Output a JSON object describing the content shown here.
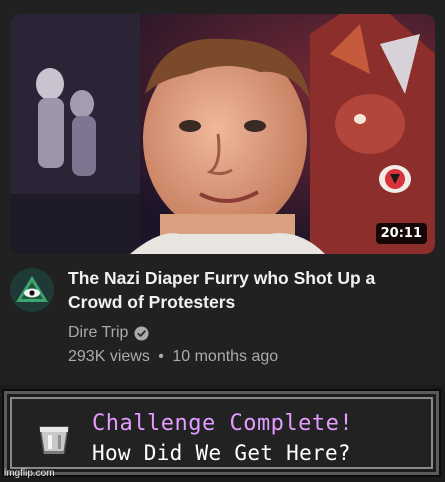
{
  "video": {
    "title": "The Nazi Diaper Furry who Shot Up a Crowd of Protesters",
    "duration": "20:11",
    "channel_name": "Dire Trip",
    "channel_verified": true,
    "views": "293K views",
    "separator": "•",
    "age": "10 months ago",
    "avatar_icon": "eye-triangle-icon",
    "verified_icon": "verified-check-icon"
  },
  "advancement": {
    "title": "Challenge Complete!",
    "description": "How Did We Get Here?",
    "icon": "bucket-icon",
    "title_color": "#e59bff",
    "description_color": "#ffffff"
  },
  "watermark": {
    "text": "imgflip.com"
  },
  "colors": {
    "background": "#212121",
    "title_text": "#f1f1f1",
    "secondary_text": "#aaaaaa",
    "accent_red": "#d8323a"
  }
}
